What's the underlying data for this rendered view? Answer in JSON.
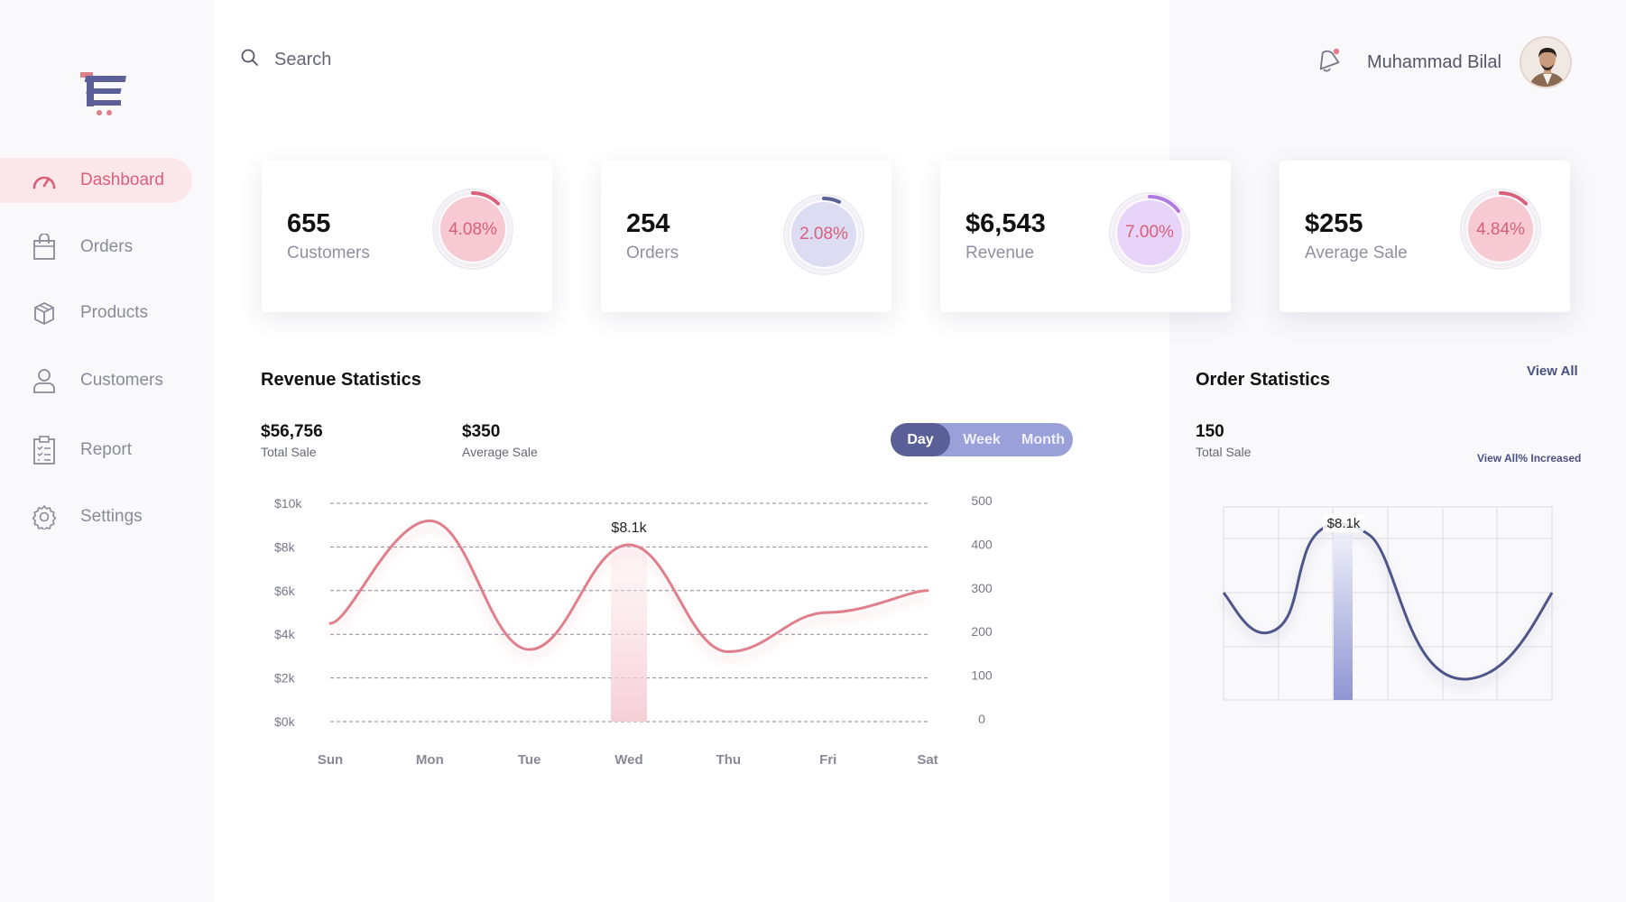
{
  "sidebar": {
    "items": [
      {
        "label": "Dashboard",
        "icon": "gauge-icon",
        "active": true
      },
      {
        "label": "Orders",
        "icon": "shopping-bag-icon",
        "active": false
      },
      {
        "label": "Products",
        "icon": "box-icon",
        "active": false
      },
      {
        "label": "Customers",
        "icon": "user-icon",
        "active": false
      },
      {
        "label": "Report",
        "icon": "clipboard-icon",
        "active": false
      },
      {
        "label": "Settings",
        "icon": "gear-icon",
        "active": false
      }
    ]
  },
  "header": {
    "search_label": "Search",
    "user_name": "Muhammad Bilal"
  },
  "kpis": [
    {
      "value": "655",
      "label": "Customers",
      "percent": "4.08%",
      "color": "#d8607a"
    },
    {
      "value": "254",
      "label": "Orders",
      "percent": "2.08%",
      "color": "#5a6097"
    },
    {
      "value": "$6,543",
      "label": "Revenue",
      "percent": "7.00%",
      "color": "#b07ae0"
    },
    {
      "value": "$255",
      "label": "Average Sale",
      "percent": "4.84%",
      "color": "#d8607a"
    }
  ],
  "revenue": {
    "title": "Revenue Statistics",
    "total_sale_value": "$56,756",
    "total_sale_label": "Total Sale",
    "avg_sale_value": "$350",
    "avg_sale_label": "Average Sale",
    "range_options": [
      "Day",
      "Week",
      "Month"
    ],
    "range_selected": "Day"
  },
  "orders": {
    "title": "Order Statistics",
    "view_all": "View All",
    "total_value": "150",
    "total_label": "Total Sale",
    "increased_link": "View All% Increased",
    "tooltip": "$8.1k",
    "highlight_color": "#8e95d2",
    "line_color": "#4e5489"
  },
  "chart_data": [
    {
      "type": "line",
      "title": "Revenue Statistics",
      "x": [
        "Sun",
        "Mon",
        "Tue",
        "Wed",
        "Thu",
        "Fri",
        "Sat"
      ],
      "y_left_ticks": [
        "$0k",
        "$2k",
        "$4k",
        "$6k",
        "$8k",
        "$10k"
      ],
      "y_right_ticks": [
        "0",
        "100",
        "200",
        "300",
        "400",
        "500"
      ],
      "ylim": [
        0,
        10
      ],
      "line_color": "#e07f8c",
      "grid": "dashed horizontal",
      "tooltip": {
        "label": "$8.1k",
        "x": "Wed"
      },
      "points": [
        {
          "x": "Sun",
          "y": 4.5
        },
        {
          "x": "Mon",
          "y": 9.2
        },
        {
          "x": "Tue",
          "y": 3.3
        },
        {
          "x": "Wed",
          "y": 8.1
        },
        {
          "x": "Thu",
          "y": 3.2
        },
        {
          "x": "Fri",
          "y": 5.0
        },
        {
          "x": "Sat",
          "y": 6.0
        }
      ]
    }
  ]
}
